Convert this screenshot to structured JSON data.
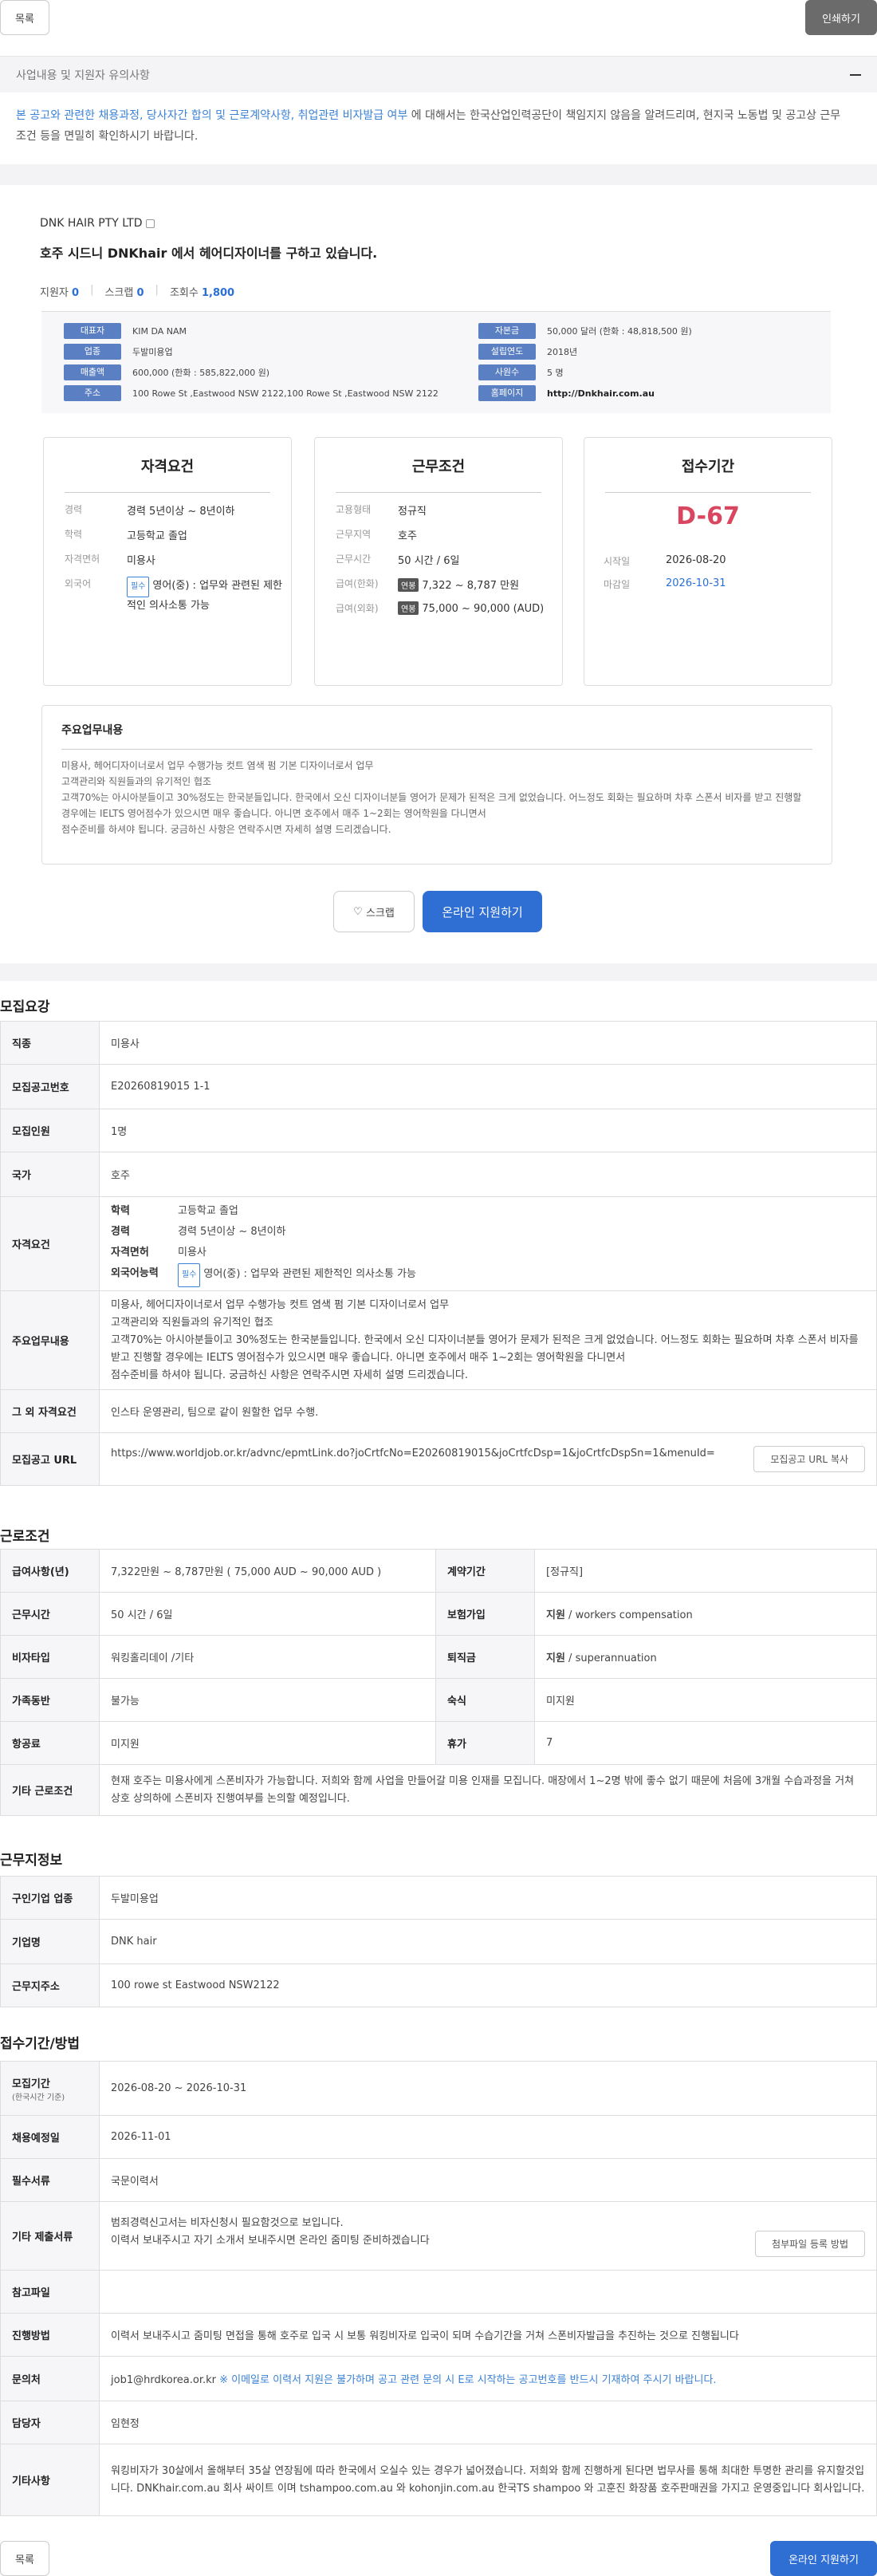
{
  "top": {
    "list_btn": "목록",
    "print_btn": "인쇄하기"
  },
  "notice": {
    "header": "사업내용 및 지원자 유의사항",
    "hl1": "본 공고와 관련한 채용과정, 당사자간 합의 및 근로계약사항, 취업관련 비자발급 여부",
    "rest": " 에 대해서는 한국산업인력공단이 책임지지 않음을 알려드리며, 현지국 노동법 및 공고상 근무조건 등을 면밀히 확인하시기 바랍니다."
  },
  "job": {
    "company": "DNK HAIR PTY LTD",
    "headline": "호주 시드니 DNKhair 에서 헤어디자이너를 구하고 있습니다.",
    "applicants_label": "지원자",
    "applicants": "0",
    "scrap_label": "스크랩",
    "scrap": "0",
    "views_label": "조회수",
    "views": "1,800"
  },
  "info": [
    {
      "k": "대표자",
      "v": "KIM DA NAM"
    },
    {
      "k": "자본금",
      "v": "50,000 달러 (한화 : 48,818,500 원)"
    },
    {
      "k": "업종",
      "v": "두발미용업"
    },
    {
      "k": "설립연도",
      "v": "2018년"
    },
    {
      "k": "매출액",
      "v": "600,000 (한화 : 585,822,000 원)"
    },
    {
      "k": "사원수",
      "v": "5 명"
    },
    {
      "k": "주소",
      "v": "100 Rowe St ,Eastwood NSW 2122,100 Rowe St ,Eastwood NSW 2122"
    },
    {
      "k": "홈페이지",
      "v": "http://Dnkhair.com.au"
    }
  ],
  "qual": {
    "title": "자격요건",
    "rows": [
      {
        "k": "경력",
        "v": "경력 5년이상 ~ 8년이하"
      },
      {
        "k": "학력",
        "v": "고등학교 졸업"
      },
      {
        "k": "자격면허",
        "v": "미용사"
      },
      {
        "k": "외국어",
        "chip": "필수",
        "v": "영어(중) : 업무와 관련된 제한적인 의사소통 가능"
      }
    ]
  },
  "work": {
    "title": "근무조건",
    "rows": [
      {
        "k": "고용형태",
        "v": "정규직"
      },
      {
        "k": "근무지역",
        "v": "호주"
      },
      {
        "k": "근무시간",
        "v": "50 시간 / 6일"
      },
      {
        "k": "급여(한화)",
        "chip": "연봉",
        "v": "7,322 ~ 8,787 만원"
      },
      {
        "k": "급여(외화)",
        "chip": "연봉",
        "v": "75,000 ~ 90,000 (AUD)"
      }
    ]
  },
  "period": {
    "title": "접수기간",
    "dday": "D-67",
    "start_label": "시작일",
    "start": "2026-08-20",
    "end_label": "마감일",
    "end": "2026-10-31"
  },
  "duty": {
    "title": "주요업무내용",
    "text": "미용사, 헤어디자이너로서 업무 수행가능 컷트 염색 펌 기본 디자이너로서 업무\n고객관리와 직원들과의 유기적인 협조\n고객70%는 아시아분들이고 30%정도는 한국분들입니다. 한국에서 오신 디자이너분들 영어가 문제가 된적은 크게 없었습니다. 어느정도 회화는 필요하며 차후 스폰서 비자를 받고 진행할 경우에는 IELTS 영어점수가 있으시면 매우 좋습니다. 아니면 호주에서 매주 1~2회는 영어학원을 다니면서\n점수준비를 하셔야 됩니다. 궁금하신 사항은 연락주시면 자세히 설명 드리겠습니다."
  },
  "actions": {
    "scrap": "스크랩",
    "apply": "온라인 지원하기"
  },
  "recruit": {
    "title": "모집요강",
    "job_k": "직종",
    "job_v": "미용사",
    "no_k": "모집공고번호",
    "no_v": "E20260819015 1-1",
    "cnt_k": "모집인원",
    "cnt_v": "1명",
    "country_k": "국가",
    "country_v": "호주",
    "qual_k": "자격요건",
    "edu_k": "학력",
    "edu_v": "고등학교 졸업",
    "car_k": "경력",
    "car_v": "경력 5년이상 ~ 8년이하",
    "lic_k": "자격면허",
    "lic_v": "미용사",
    "lang_k": "외국어능력",
    "lang_chip": "필수",
    "lang_v": "영어(중) : 업무와 관련된 제한적인 의사소통 가능",
    "duty_k": "주요업무내용",
    "duty_v": "미용사, 헤어디자이너로서 업무 수행가능 컷트 염색 펌 기본 디자이너로서 업무\n고객관리와 직원들과의 유기적인 협조\n고객70%는 아시아분들이고 30%정도는 한국분들입니다. 한국에서 오신 디자이너분들 영어가 문제가 된적은 크게 없었습니다. 어느정도 회화는 필요하며 차후 스폰서 비자를 받고 진행할 경우에는 IELTS 영어점수가 있으시면 매우 좋습니다. 아니면 호주에서 매주 1~2회는 영어학원을 다니면서\n점수준비를 하셔야 됩니다. 궁금하신 사항은 연락주시면 자세히 설명 드리겠습니다.",
    "etc_k": "그 외 자격요건",
    "etc_v": "인스타 운영관리, 팀으로 같이 원할한 업무 수행.",
    "url_k": "모집공고 URL",
    "url_v": "https://www.worldjob.or.kr/advnc/epmtLink.do?joCrtfcNo=E20260819015&joCrtfcDsp=1&joCrtfcDspSn=1&menuId=",
    "url_btn": "모집공고 URL 복사"
  },
  "labor": {
    "title": "근로조건",
    "pay_k": "급여사항(년)",
    "pay_v": "7,322만원 ~ 8,787만원 ( 75,000 AUD ~ 90,000 AUD )",
    "contract_k": "계약기간",
    "contract_v": "[정규직]",
    "hours_k": "근무시간",
    "hours_v": "50 시간 / 6일",
    "ins_k": "보험가입",
    "ins_b": "지원",
    "ins_v": " / workers compensation",
    "visa_k": "비자타입",
    "visa_v": "워킹홀리데이 /기타",
    "ret_k": "퇴직금",
    "ret_b": "지원",
    "ret_v": " / superannuation",
    "fam_k": "가족동반",
    "fam_v": "불가능",
    "house_k": "숙식",
    "house_v": "미지원",
    "air_k": "항공료",
    "air_v": "미지원",
    "vac_k": "휴가",
    "vac_v": "7",
    "other_k": "기타 근로조건",
    "other_v": "현재 호주는 미용사에게 스폰비자가 가능합니다. 저희와 함께 사업을 만들어갈 미용 인재를 모집니다. 매장에서 1~2명 밖에 좋수 없기 때문에 처음에 3개월 수습과정을 거쳐 상호 상의하에 스폰비자 진행여부를 논의할 예정입니다."
  },
  "place": {
    "title": "근무지정보",
    "ind_k": "구인기업 업종",
    "ind_v": "두발미용업",
    "name_k": "기업명",
    "name_v": "DNK hair",
    "addr_k": "근무지주소",
    "addr_v": "100 rowe st Eastwood NSW2122"
  },
  "apply": {
    "title": "접수기간/방법",
    "period_k": "모집기간",
    "period_sub": "(한국시간 기준)",
    "period_v": "2026-08-20 ~ 2026-10-31",
    "hire_k": "채용예정일",
    "hire_v": "2026-11-01",
    "docs_k": "필수서류",
    "docs_v": "국문이력서",
    "etc_k": "기타 제출서류",
    "etc_v": "범죄경력신고서는 비자신청시 필요함것으로 보입니다.\n이력서 보내주시고 자기 소개서 보내주시면 온라인 줌미팅 준비하겠습니다",
    "etc_btn": "첨부파일 등록 방법",
    "file_k": "참고파일",
    "file_v": "",
    "method_k": "진행방법",
    "method_v": "이력서 보내주시고 줌미팅 면접을 통해 호주로 입국 시 보통 워킹비자로 입국이 되며 수습기간을 거쳐 스폰비자발급을 추진하는 것으로 진행됩니다",
    "contact_k": "문의처",
    "contact_v": "job1@hrdkorea.or.kr",
    "contact_note": " ※ 이메일로 이력서 지원은 불가하며 공고 관련 문의 시 E로 시작하는 공고번호를 반드시 기재하여 주시기 바랍니다.",
    "mgr_k": "담당자",
    "mgr_v": "임현정",
    "misc_k": "기타사항",
    "misc_v": "워킹비자가 30살에서 올해부터 35살 연장됨에 따라 한국에서 오실수 있는 경우가 넓어졌습니다. 저희와 함께 진행하게 된다면 법무사를 통해 최대한 투명한 관리를 유지할것입니다. DNKhair.com.au 회사 싸이트 이며 tshampoo.com.au 와 kohonjin.com.au 한국TS shampoo 와 고훈진 화장품 호주판매권을 가지고 운영중입니다 회사입니다."
  },
  "bottom": {
    "list_btn": "목록",
    "apply_btn": "온라인 지원하기"
  }
}
